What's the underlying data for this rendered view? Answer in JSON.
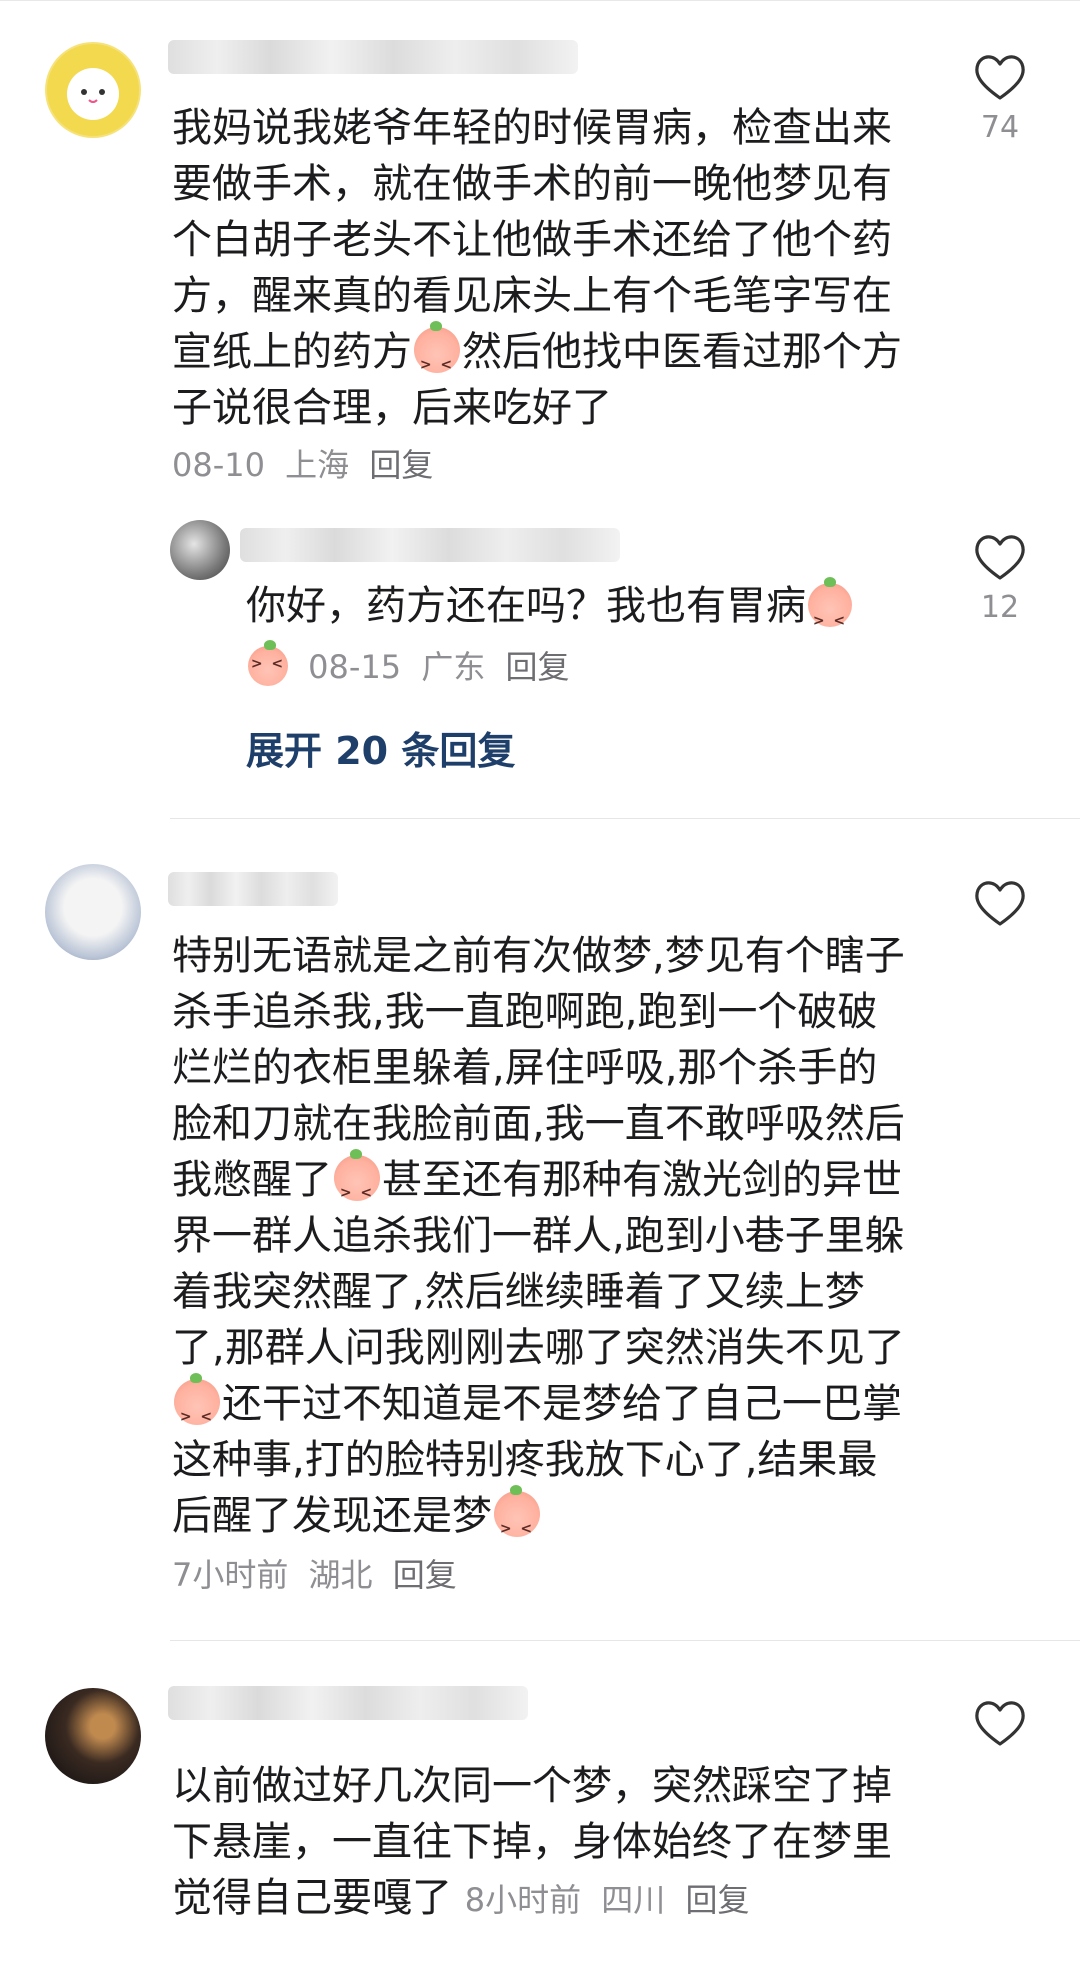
{
  "comments": [
    {
      "text": "我妈说我姥爷年轻的时候胃病，检查出来要做手术，就在做手术的前一晚他梦见有个白胡子老头不让他做手术还给了他个药方，醒来真的看见床头上有个毛笔字写在宣纸上的药方",
      "text_tail": "然后他找中医看过那个方子说很合理，后来吃好了",
      "date": "08-10",
      "location": "上海",
      "reply_label": "回复",
      "likes": "74",
      "reply": {
        "text": "你好，药方还在吗？我也有胃病",
        "date": "08-15",
        "location": "广东",
        "reply_label": "回复",
        "likes": "12"
      },
      "expand_label": "展开 20 条回复"
    },
    {
      "text_parts": [
        "特别无语就是之前有次做梦,梦见有个瞎子杀手追杀我,我一直跑啊跑,跑到一个破破烂烂的衣柜里躲着,屏住呼吸,那个杀手的脸和刀就在我脸前面,我一直不敢呼吸然后我憋醒了",
        "甚至还有那种有激光剑的异世界一群人追杀我们一群人,跑到小巷子里躲着我突然醒了,然后继续睡着了又续上梦了,那群人问我刚刚去哪了突然消失不见了",
        "还干过不知道是不是梦给了自己一巴掌这种事,打的脸特别疼我放下心了,结果最后醒了发现还是梦"
      ],
      "date": "7小时前",
      "location": "湖北",
      "reply_label": "回复"
    },
    {
      "text": "以前做过好几次同一个梦，突然踩空了掉下悬崖，一直往下掉，身体始终了在梦里觉得自己要嘎了",
      "date": "8小时前",
      "location": "四川",
      "reply_label": "回复"
    }
  ],
  "colors": {
    "accent": "#1f3f6b",
    "meta": "#8e8e93",
    "text": "#1c1c1e"
  },
  "icons": {
    "like": "heart-outline-icon",
    "emoji": "peach-crying-emoji"
  }
}
